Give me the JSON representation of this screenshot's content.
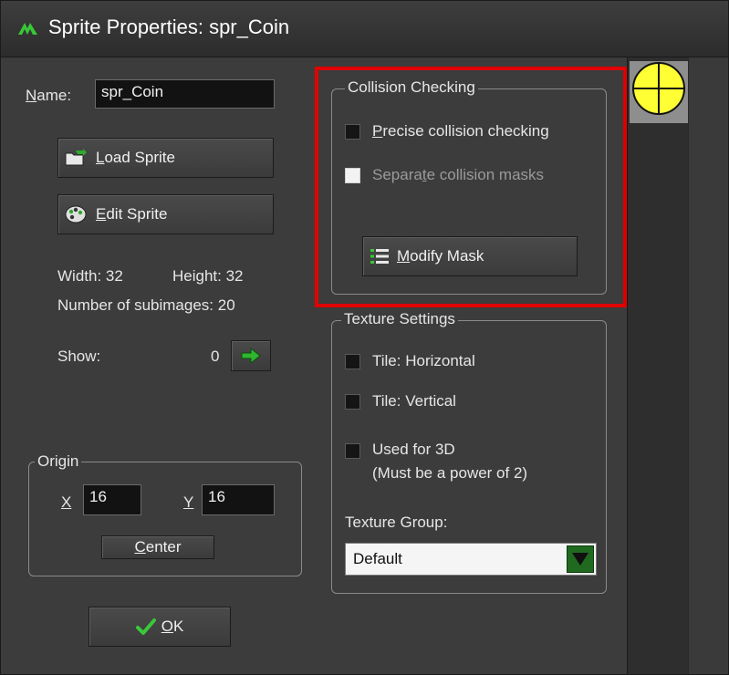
{
  "window": {
    "title": "Sprite Properties: spr_Coin"
  },
  "name": {
    "label_underlined": "N",
    "label_rest": "ame:",
    "value": "spr_Coin"
  },
  "buttons": {
    "load_sprite": {
      "underlined": "L",
      "rest": "oad Sprite"
    },
    "edit_sprite": {
      "underlined": "E",
      "rest": "dit Sprite"
    },
    "center": {
      "underlined": "C",
      "rest": "enter"
    },
    "ok": {
      "underlined": "O",
      "rest": "K"
    },
    "modify_mask": {
      "underlined": "M",
      "rest": "odify Mask"
    }
  },
  "info": {
    "width_label": "Width: 32",
    "height_label": "Height: 32",
    "subimages_label": "Number of subimages: 20",
    "show_label": "Show:",
    "show_value": "0"
  },
  "origin": {
    "title": "Origin",
    "x_label": "X",
    "x_value": "16",
    "y_label": "Y",
    "y_value": "16"
  },
  "collision": {
    "title": "Collision Checking",
    "precise": {
      "underlined": "P",
      "rest": "recise collision checking",
      "checked": false
    },
    "separate": {
      "before": "Separa",
      "underlined": "t",
      "after": "e collision masks",
      "checked": false,
      "enabled": false
    }
  },
  "texture": {
    "title": "Texture Settings",
    "tile_h": "Tile: Horizontal",
    "tile_v": "Tile: Vertical",
    "used_3d": "Used for 3D",
    "used_3d_note": "(Must be a power of 2)",
    "group_label": "Texture Group:",
    "group_value": "Default"
  },
  "colors": {
    "highlight": "#e00000",
    "accent_green": "#1f8a1f",
    "coin_yellow": "#ffff33"
  },
  "icons": [
    "app-icon",
    "load-folder-icon",
    "edit-palette-icon",
    "next-arrow-icon",
    "checkmark-icon",
    "mask-list-icon",
    "dropdown-arrow-icon",
    "coin-sprite-icon"
  ]
}
